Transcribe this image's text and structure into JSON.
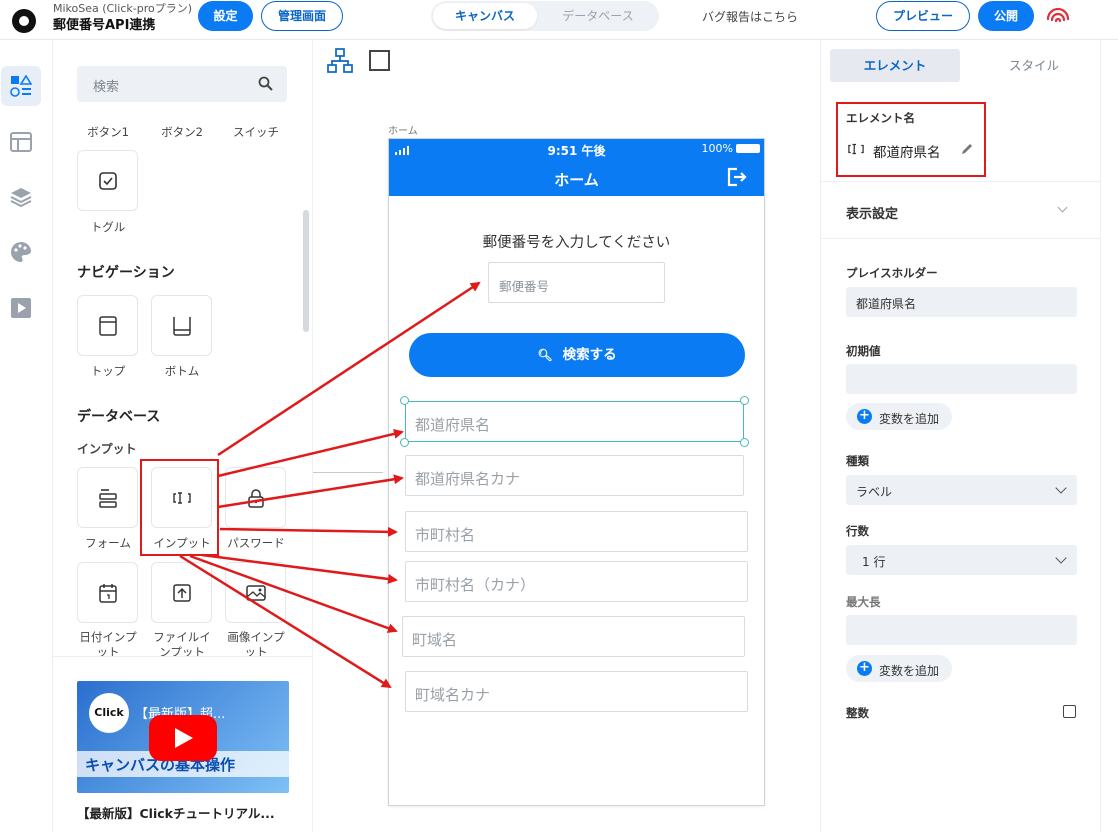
{
  "header": {
    "subtitle": "MikoSea (Click-proプラン)",
    "app_title": "郵便番号API連携",
    "settings_label": "設定",
    "admin_label": "管理画面",
    "tab_canvas": "キャンバス",
    "tab_database": "データベース",
    "bug_report": "バグ報告はこちら",
    "preview_label": "プレビュー",
    "publish_label": "公開"
  },
  "components": {
    "search_placeholder": "検索",
    "button_row": [
      "ボタン1",
      "ボタン2",
      "スイッチ"
    ],
    "toggle_label": "トグル",
    "nav_heading": "ナビゲーション",
    "nav_items": [
      "トップ",
      "ボトム"
    ],
    "db_heading": "データベース",
    "input_subheading": "インプット",
    "input_items": [
      "フォーム",
      "インプット",
      "パスワード"
    ],
    "input_items2": [
      "日付インプット",
      "ファイルインプット",
      "画像インプット"
    ],
    "video_title": "【最新版】超...",
    "video_brand": "Click",
    "video_banner": "キャンバスの基本操作",
    "video_caption": "【最新版】Clickチュートリアル..."
  },
  "canvas": {
    "screen_label": "ホーム",
    "status_time": "9:51 午後",
    "battery": "100%",
    "screen_title": "ホーム",
    "prompt": "郵便番号を入力してください",
    "zip_placeholder": "郵便番号",
    "search_button": "検索する",
    "fields": [
      "都道府県名",
      "都道府県名カナ",
      "市町村名",
      "市町村名（カナ）",
      "町域名",
      "町域名カナ"
    ]
  },
  "inspector": {
    "tab_element": "エレメント",
    "tab_style": "スタイル",
    "element_name_label": "エレメント名",
    "element_name": "都道府県名",
    "display_settings": "表示設定",
    "placeholder_label": "プレイスホルダー",
    "placeholder_value": "都道府県名",
    "initial_label": "初期値",
    "add_var": "変数を追加",
    "type_label": "種類",
    "type_value": "ラベル",
    "rows_label": "行数",
    "rows_value": "1 行",
    "maxlen_label": "最大長",
    "integer_label": "整数"
  },
  "colors": {
    "accent": "#0a7bf2",
    "annotation": "#e01a1a",
    "selection": "#48b8b8"
  }
}
